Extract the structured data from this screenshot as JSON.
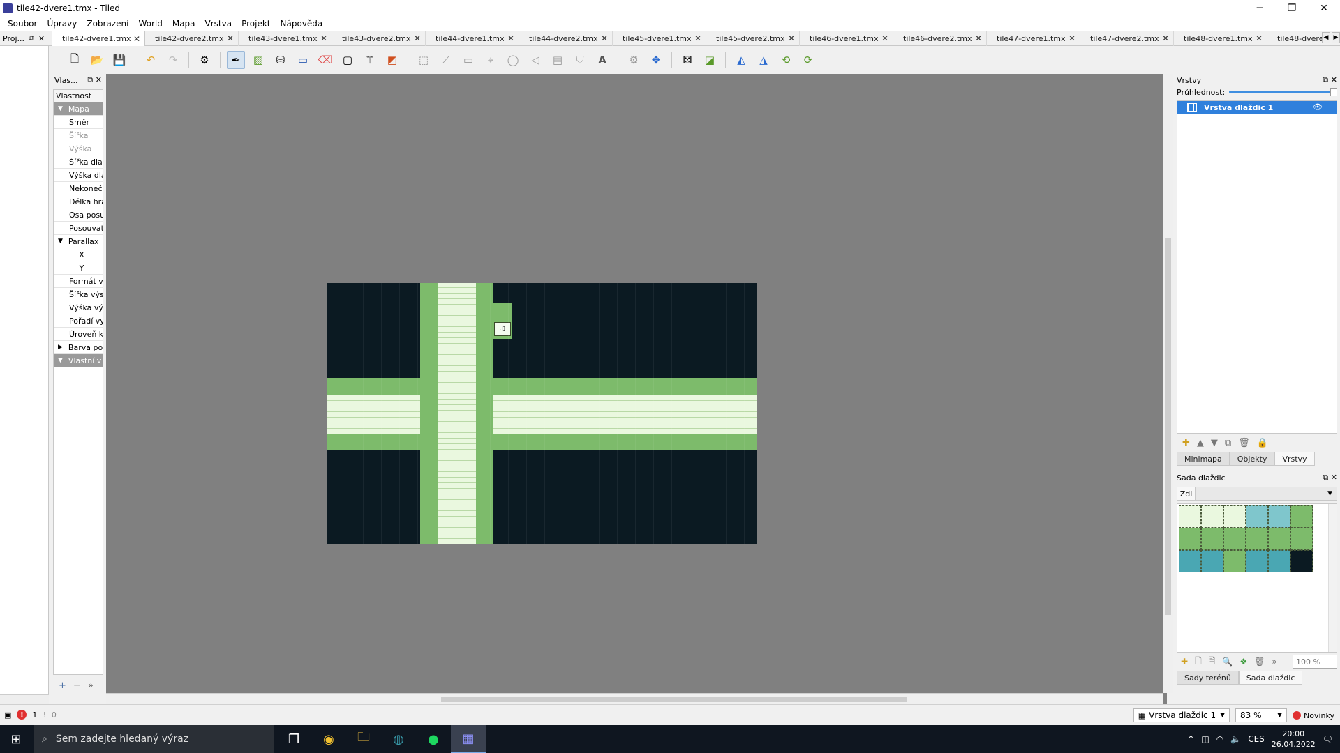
{
  "window": {
    "title": "tile42-dvere1.tmx - Tiled",
    "minimize": "─",
    "maximize": "❐",
    "close": "✕"
  },
  "menu": [
    "Soubor",
    "Úpravy",
    "Zobrazení",
    "World",
    "Mapa",
    "Vrstva",
    "Projekt",
    "Nápověda"
  ],
  "left_dock": {
    "title": "Proj..."
  },
  "tabs": [
    {
      "label": "tile42-dvere1.tmx",
      "active": true
    },
    {
      "label": "tile42-dvere2.tmx"
    },
    {
      "label": "tile43-dvere1.tmx"
    },
    {
      "label": "tile43-dvere2.tmx"
    },
    {
      "label": "tile44-dvere1.tmx"
    },
    {
      "label": "tile44-dvere2.tmx"
    },
    {
      "label": "tile45-dvere1.tmx"
    },
    {
      "label": "tile45-dvere2.tmx"
    },
    {
      "label": "tile46-dvere1.tmx"
    },
    {
      "label": "tile46-dvere2.tmx"
    },
    {
      "label": "tile47-dvere1.tmx"
    },
    {
      "label": "tile47-dvere2.tmx"
    },
    {
      "label": "tile48-dvere1.tmx"
    },
    {
      "label": "tile48-dvere"
    }
  ],
  "properties": {
    "dock_title": "Vlas...",
    "column_header": "Vlastnost",
    "rows": [
      {
        "label": "Mapa",
        "kind": "group"
      },
      {
        "label": "Směr"
      },
      {
        "label": "Šířka",
        "kind": "disabled"
      },
      {
        "label": "Výška",
        "kind": "disabled"
      },
      {
        "label": "Šířka dla"
      },
      {
        "label": "Výška dlá"
      },
      {
        "label": "Nekonečn"
      },
      {
        "label": "Délka hra"
      },
      {
        "label": "Osa posu"
      },
      {
        "label": "Posouvat"
      },
      {
        "label": "Parallax",
        "kind": "sub-open"
      },
      {
        "label": "X",
        "kind": "center"
      },
      {
        "label": "Y",
        "kind": "center"
      },
      {
        "label": "Formát v"
      },
      {
        "label": "Šířka výs"
      },
      {
        "label": "Výška vý"
      },
      {
        "label": "Pořadí vy"
      },
      {
        "label": "Úroveň k"
      },
      {
        "label": "Barva po",
        "kind": "sub-closed"
      },
      {
        "label": "Vlastní v",
        "kind": "group"
      }
    ]
  },
  "layers_panel": {
    "title": "Vrstvy",
    "opacity_label": "Průhlednost:",
    "opacity": 1.0,
    "layer_name": "Vrstva dlaždic 1",
    "tabs": [
      "Minimapa",
      "Objekty",
      "Vrstvy"
    ],
    "active_tab": "Vrstvy"
  },
  "tileset_panel": {
    "title": "Sada dlaždic",
    "tileset_name": "Zdi",
    "zoom": "100 %",
    "tabs": [
      "Sady terénů",
      "Sada dlaždic"
    ],
    "active_tab": "Sada dlaždic"
  },
  "status": {
    "errors": "1",
    "warnings": "0",
    "layer_select": "Vrstva dlaždic 1",
    "zoom": "83 %",
    "news": "Novinky"
  },
  "taskbar": {
    "search_placeholder": "Sem zadejte hledaný výraz",
    "lang": "CES",
    "time": "20:00",
    "date": "26.04.2022"
  },
  "colors": {
    "accent": "#2f80dc",
    "map_bg": "#0b1a22",
    "wall_green": "#7dbb6b",
    "floor_light": "#eaf8df",
    "canvas_bg": "#808080"
  }
}
